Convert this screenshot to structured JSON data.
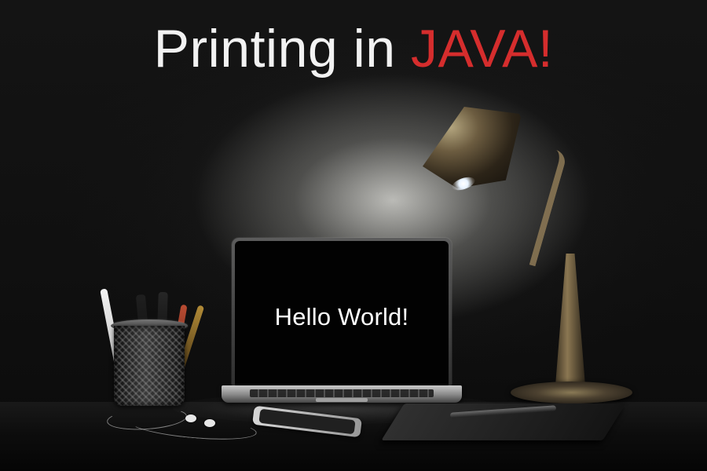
{
  "headline": {
    "prefix": "Printing in",
    "accent": "JAVA!",
    "accent_color": "#d52d2d"
  },
  "laptop": {
    "screen_text": "Hello World!"
  },
  "objects": {
    "lamp": "desk-lamp-icon",
    "pen_cup": "pen-cup-icon",
    "phone": "phone-icon",
    "notebook": "notebook-icon"
  }
}
